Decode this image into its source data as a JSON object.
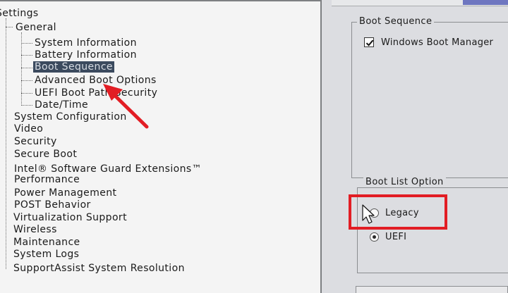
{
  "tree": {
    "root_label": "Settings",
    "general": {
      "label": "General",
      "children": [
        "System Information",
        "Battery Information",
        "Boot Sequence",
        "Advanced Boot Options",
        "UEFI Boot Path Security",
        "Date/Time"
      ]
    },
    "sections": [
      "System Configuration",
      "Video",
      "Security",
      "Secure Boot",
      "Intel® Software Guard Extensions™",
      "Performance",
      "Power Management",
      "POST Behavior",
      "Virtualization Support",
      "Wireless",
      "Maintenance",
      "System Logs",
      "SupportAssist System Resolution"
    ]
  },
  "boot_sequence": {
    "title": "Boot Sequence",
    "items": [
      {
        "label": "Windows Boot Manager",
        "checked": true
      }
    ]
  },
  "boot_list_option": {
    "title": "Boot List Option",
    "options": [
      {
        "label": "Legacy",
        "selected": false
      },
      {
        "label": "UEFI",
        "selected": true
      }
    ]
  },
  "annotation_color": "#e21d24",
  "selection_color": "#3b4a5e"
}
